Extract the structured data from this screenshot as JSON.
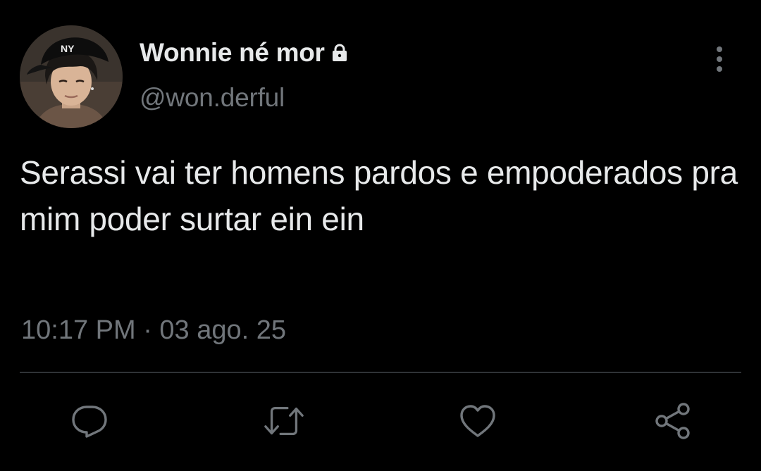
{
  "user": {
    "display_name": "Wonnie né mor",
    "handle": "@won.derful",
    "protected_icon": "lock-icon",
    "avatar": "profile-photo"
  },
  "tweet": {
    "text": "Serassi vai ter homens pardos e empoderados pra mim poder surtar ein ein",
    "timestamp": "10:17 PM · 03 ago. 25"
  },
  "actions": [
    {
      "icon": "reply-icon"
    },
    {
      "icon": "retweet-icon"
    },
    {
      "icon": "like-icon"
    },
    {
      "icon": "share-icon"
    }
  ],
  "menu": {
    "icon": "more-vertical-icon"
  },
  "colors": {
    "background": "#000000",
    "primary_text": "#e7e9ea",
    "secondary_text": "#71767b",
    "divider": "#2f3336"
  }
}
